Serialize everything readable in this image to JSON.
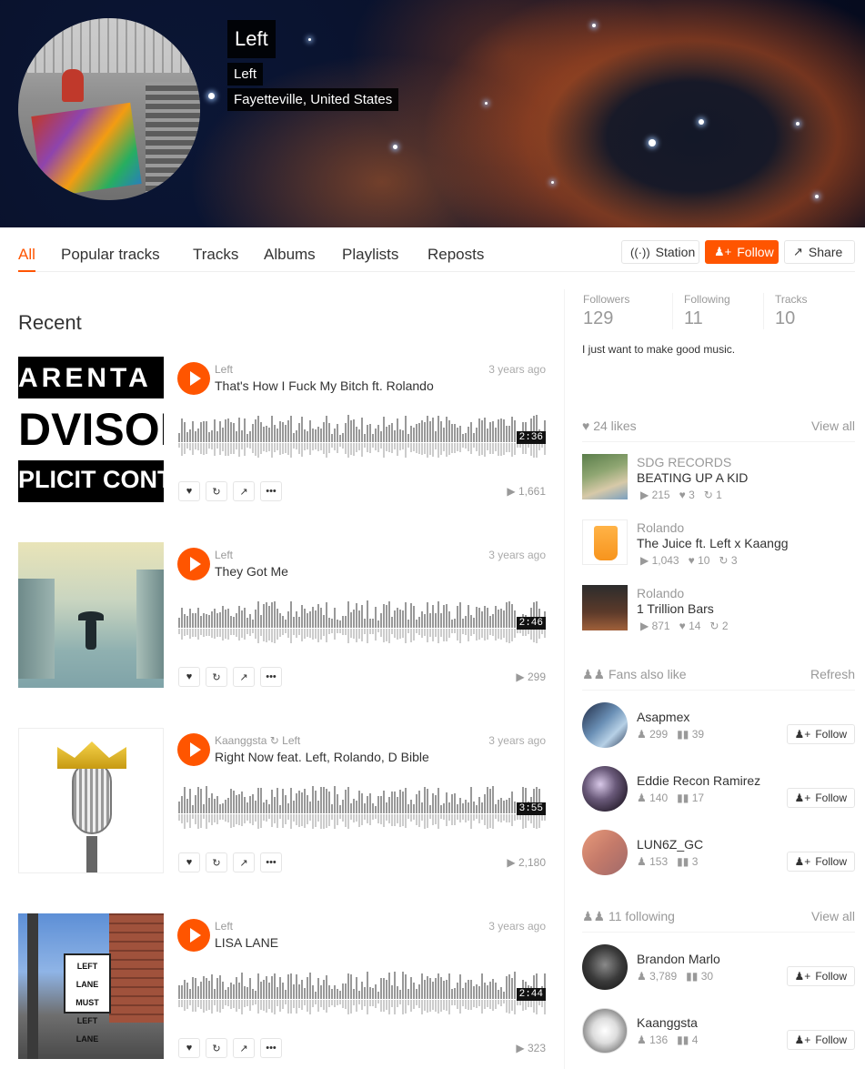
{
  "profile": {
    "display_name": "Left",
    "username": "Left",
    "location": "Fayetteville, United States",
    "bio": "I just want to make good music."
  },
  "nav": {
    "tabs": [
      "All",
      "Popular tracks",
      "Tracks",
      "Albums",
      "Playlists",
      "Reposts"
    ],
    "active_tab": "All",
    "station_label": "Station",
    "follow_label": "Follow",
    "share_label": "Share"
  },
  "stats": {
    "followers_label": "Followers",
    "followers": "129",
    "following_label": "Following",
    "following": "11",
    "tracks_label": "Tracks",
    "tracks": "10"
  },
  "recent": {
    "title": "Recent",
    "tracks": [
      {
        "user": "Left",
        "reposted_by": "",
        "title": "That's How I Fuck My Bitch ft. Rolando",
        "date": "3 years ago",
        "duration": "2:36",
        "plays": "1,661"
      },
      {
        "user": "Left",
        "reposted_by": "",
        "title": "They Got Me",
        "date": "3 years ago",
        "duration": "2:46",
        "plays": "299"
      },
      {
        "user": "Kaanggsta",
        "reposted_by": "Left",
        "title": "Right Now feat. Left, Rolando, D Bible",
        "date": "3 years ago",
        "duration": "3:55",
        "plays": "2,180"
      },
      {
        "user": "Left",
        "reposted_by": "",
        "title": "LISA LANE",
        "date": "3 years ago",
        "duration": "2:44",
        "plays": "323"
      }
    ]
  },
  "artwork_text": {
    "advisory": [
      "ARENTA",
      "DVISOR",
      "PLICIT CONTE"
    ],
    "sign": [
      "LEFT LANE",
      "MUST",
      "LEFT LANE"
    ]
  },
  "likes": {
    "header": "24 likes",
    "view_all": "View all",
    "items": [
      {
        "user": "SDG RECORDS",
        "title": "BEATING UP A KID",
        "plays": "215",
        "likes": "3",
        "reposts": "1"
      },
      {
        "user": "Rolando",
        "title": "The Juice ft. Left x Kaangg",
        "plays": "1,043",
        "likes": "10",
        "reposts": "3"
      },
      {
        "user": "Rolando",
        "title": "1 Trillion Bars",
        "plays": "871",
        "likes": "14",
        "reposts": "2"
      }
    ]
  },
  "fans": {
    "header": "Fans also like",
    "refresh": "Refresh",
    "items": [
      {
        "name": "Asapmex",
        "followers": "299",
        "tracks": "39",
        "follow": "Follow"
      },
      {
        "name": "Eddie Recon Ramirez",
        "followers": "140",
        "tracks": "17",
        "follow": "Follow"
      },
      {
        "name": "LUN6Z_GC",
        "followers": "153",
        "tracks": "3",
        "follow": "Follow"
      }
    ]
  },
  "following_list": {
    "header": "11 following",
    "view_all": "View all",
    "items": [
      {
        "name": "Brandon Marlo",
        "followers": "3,789",
        "tracks": "30",
        "follow": "Follow"
      },
      {
        "name": "Kaanggsta",
        "followers": "136",
        "tracks": "4",
        "follow": "Follow"
      }
    ]
  },
  "colors": {
    "accent": "#ff5500",
    "muted": "#999999"
  },
  "icons": [
    "play-icon",
    "heart-icon",
    "repost-icon",
    "share-icon",
    "more-icon",
    "station-icon",
    "follow-user-icon",
    "users-icon",
    "waveform-icon"
  ]
}
